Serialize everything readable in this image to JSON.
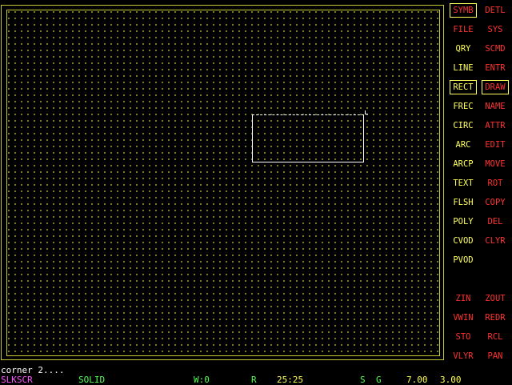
{
  "colors": {
    "background": "#000000",
    "frame": "#c8c832",
    "grid_dot": "#a0a030",
    "menu_yellow": "#ffff55",
    "menu_red": "#ff3030",
    "rubberband": "#ffffff",
    "prompt": "#ffffff",
    "layer_magenta": "#ff55ff",
    "status_green": "#55ff55"
  },
  "menu": {
    "left": [
      {
        "label": "SYMB",
        "color": "red",
        "boxed": true
      },
      {
        "label": "FILE",
        "color": "red",
        "boxed": false
      },
      {
        "label": "QRY",
        "color": "yellow",
        "boxed": false
      },
      {
        "label": "LINE",
        "color": "yellow",
        "boxed": false
      },
      {
        "label": "RECT",
        "color": "yellow",
        "boxed": true
      },
      {
        "label": "FREC",
        "color": "yellow",
        "boxed": false
      },
      {
        "label": "CIRC",
        "color": "yellow",
        "boxed": false
      },
      {
        "label": "ARC",
        "color": "yellow",
        "boxed": false
      },
      {
        "label": "ARCP",
        "color": "yellow",
        "boxed": false
      },
      {
        "label": "TEXT",
        "color": "yellow",
        "boxed": false
      },
      {
        "label": "FLSH",
        "color": "yellow",
        "boxed": false
      },
      {
        "label": "POLY",
        "color": "yellow",
        "boxed": false
      },
      {
        "label": "CVOD",
        "color": "yellow",
        "boxed": false
      },
      {
        "label": "PVOD",
        "color": "yellow",
        "boxed": false
      }
    ],
    "right": [
      {
        "label": "DETL",
        "color": "red",
        "boxed": false
      },
      {
        "label": "SYS",
        "color": "red",
        "boxed": false
      },
      {
        "label": "SCMD",
        "color": "red",
        "boxed": false
      },
      {
        "label": "ENTR",
        "color": "red",
        "boxed": false
      },
      {
        "label": "DRAW",
        "color": "red",
        "boxed": true
      },
      {
        "label": "NAME",
        "color": "red",
        "boxed": false
      },
      {
        "label": "ATTR",
        "color": "red",
        "boxed": false
      },
      {
        "label": "EDIT",
        "color": "red",
        "boxed": false
      },
      {
        "label": "MOVE",
        "color": "red",
        "boxed": false
      },
      {
        "label": "ROT",
        "color": "red",
        "boxed": false
      },
      {
        "label": "COPY",
        "color": "red",
        "boxed": false
      },
      {
        "label": "DEL",
        "color": "red",
        "boxed": false
      },
      {
        "label": "CLYR",
        "color": "red",
        "boxed": false
      }
    ],
    "view_left": [
      {
        "label": "ZIN",
        "color": "red"
      },
      {
        "label": "VWIN",
        "color": "red"
      },
      {
        "label": "STO",
        "color": "red"
      },
      {
        "label": "VLYR",
        "color": "red"
      }
    ],
    "view_right": [
      {
        "label": "ZOUT",
        "color": "red"
      },
      {
        "label": "REDR",
        "color": "red"
      },
      {
        "label": "RCL",
        "color": "red"
      },
      {
        "label": "PAN",
        "color": "red"
      }
    ]
  },
  "prompt": {
    "text": "corner 2...."
  },
  "status": {
    "layer": "SLKSCR",
    "line_style": "SOLID",
    "width": "W:0",
    "mode": "R",
    "coords": "25:25",
    "snap": "S",
    "grid": "G",
    "grid_value": "7.00",
    "snap_value": "3.00"
  }
}
